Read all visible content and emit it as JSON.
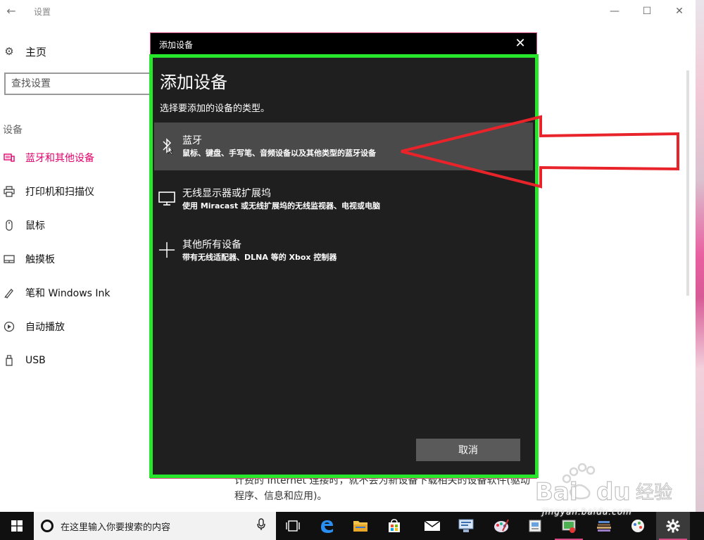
{
  "window": {
    "title": "设置",
    "back_icon": "back-arrow-icon"
  },
  "sidebar": {
    "home_label": "主页",
    "search_placeholder": "查找设置",
    "section": "设备",
    "items": [
      {
        "label": "蓝牙和其他设备",
        "icon": "bluetooth-devices-icon",
        "active": true
      },
      {
        "label": "打印机和扫描仪",
        "icon": "printer-icon",
        "active": false
      },
      {
        "label": "鼠标",
        "icon": "mouse-icon",
        "active": false
      },
      {
        "label": "触摸板",
        "icon": "touchpad-icon",
        "active": false
      },
      {
        "label": "笔和 Windows Ink",
        "icon": "pen-icon",
        "active": false
      },
      {
        "label": "自动播放",
        "icon": "autoplay-icon",
        "active": false
      },
      {
        "label": "USB",
        "icon": "usb-icon",
        "active": false
      }
    ]
  },
  "background_text": {
    "line1": "计费的 Internet 连接时，就不会为新设备下载相关的设备软件(驱动",
    "line2": "程序、信息和应用)。"
  },
  "dialog": {
    "window_title": "添加设备",
    "heading": "添加设备",
    "subtitle": "选择要添加的设备的类型。",
    "options": [
      {
        "title": "蓝牙",
        "desc": "鼠标、键盘、手写笔、音频设备以及其他类型的蓝牙设备",
        "icon": "bluetooth-icon",
        "highlighted": true
      },
      {
        "title": "无线显示器或扩展坞",
        "desc": "使用 Miracast 或无线扩展坞的无线监视器、电视或电脑",
        "icon": "monitor-icon",
        "highlighted": false
      },
      {
        "title": "其他所有设备",
        "desc": "带有无线适配器、DLNA 等的 Xbox 控制器",
        "icon": "plus-icon",
        "highlighted": false
      }
    ],
    "cancel_label": "取消"
  },
  "annotations": {
    "frame_color": "#27e62b",
    "arrow_color": "#e8232a"
  },
  "taskbar": {
    "search_placeholder": "在这里输入你要搜索的内容",
    "icons": [
      "task-view-icon",
      "edge-icon",
      "file-explorer-icon",
      "store-icon",
      "mail-icon",
      "app-icon-1",
      "paint-icon",
      "app-icon-2",
      "app-icon-3",
      "app-icon-4",
      "settings-icon"
    ]
  },
  "watermark": {
    "text": "jingyan.baidu.com"
  },
  "colors": {
    "accent": "#e3006d",
    "dialog_bg": "#1f1f1f",
    "highlight_row": "#4a4a4a"
  }
}
